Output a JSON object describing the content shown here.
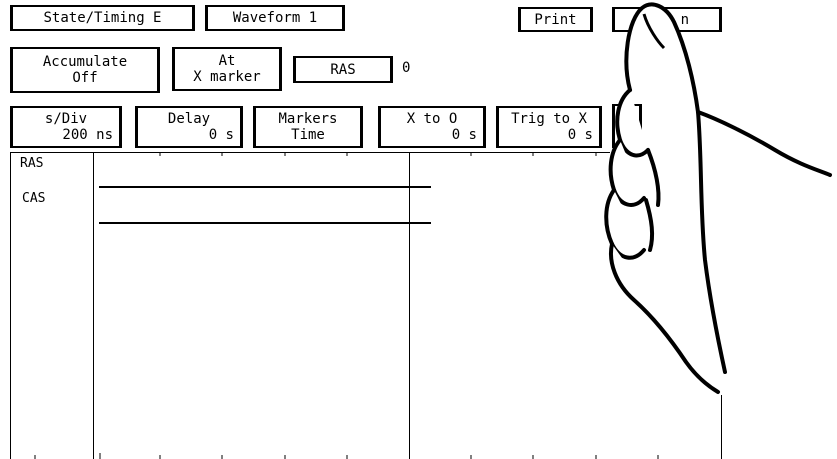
{
  "top_row": {
    "menu_label": "State/Timing E",
    "waveform_label": "Waveform 1",
    "print_label": "Print",
    "run_label_partial": "n"
  },
  "row2": {
    "accumulate_line1": "Accumulate",
    "accumulate_line2": "Off",
    "at_line1": "At",
    "at_line2": "X marker",
    "label_button": "RAS",
    "label_value": "0"
  },
  "row3": {
    "sdiv_line1": "s/Div",
    "sdiv_line2": "200 ns",
    "delay_line1": "Delay",
    "delay_line2": "0  s",
    "markers_line1": "Markers",
    "markers_line2": "Time",
    "xto0_line1": "X to O",
    "xto0_line2": "0  s",
    "trigtox_line1": "Trig to X",
    "trigtox_line2": "0  s",
    "partial_label": "T"
  },
  "waveform": {
    "channels": [
      "RAS",
      "CAS"
    ]
  }
}
